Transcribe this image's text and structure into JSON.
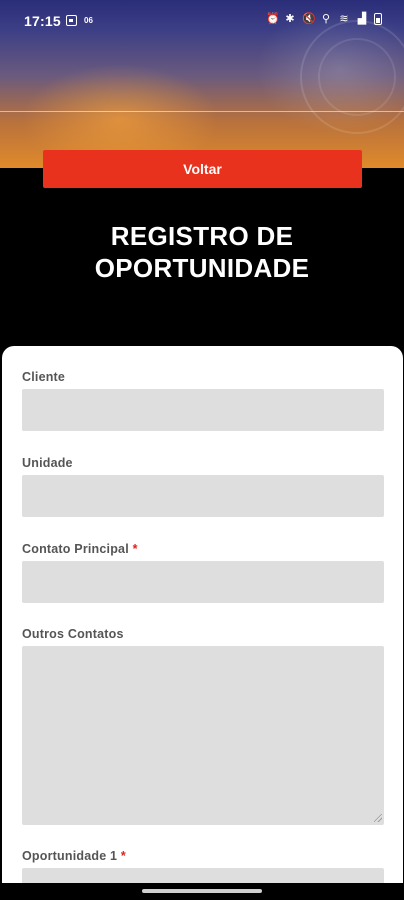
{
  "status_bar": {
    "time": "17:15",
    "date_badge": "06"
  },
  "header": {
    "back_label": "Voltar",
    "title_line1": "REGISTRO DE",
    "title_line2": "OPORTUNIDADE"
  },
  "form": {
    "fields": [
      {
        "label": "Cliente",
        "required": false,
        "value": "",
        "type": "text"
      },
      {
        "label": "Unidade",
        "required": false,
        "value": "",
        "type": "text"
      },
      {
        "label": "Contato Principal",
        "required": true,
        "value": "",
        "type": "text"
      },
      {
        "label": "Outros Contatos",
        "required": false,
        "value": "",
        "type": "textarea"
      },
      {
        "label": "Oportunidade 1",
        "required": true,
        "value": "",
        "type": "text"
      }
    ],
    "required_marker": "*"
  },
  "colors": {
    "accent": "#e8321e",
    "input_bg": "#dedede",
    "required": "#e02020"
  }
}
